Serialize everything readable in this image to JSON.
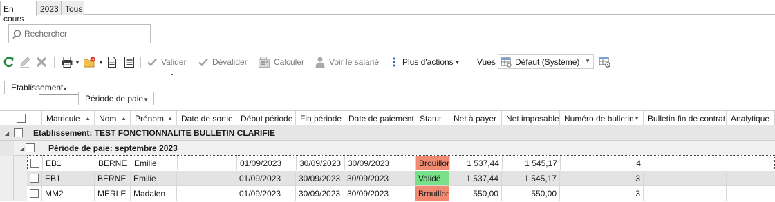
{
  "tabs": [
    {
      "label": "En cours",
      "active": true
    },
    {
      "label": "2023",
      "active": false
    },
    {
      "label": "Tous",
      "active": false
    }
  ],
  "search": {
    "placeholder": "Rechercher",
    "value": ""
  },
  "toolbar": {
    "validate_label": "Valider",
    "unvalidate_label": "Dévalider",
    "calculate_label": "Calculer",
    "view_employee_label": "Voir le salarié",
    "more_actions_label": "Plus d'actions",
    "views_label": "Vues",
    "views_selected": "Défaut (Système)"
  },
  "grouping": {
    "level1": "Etablissement",
    "level2": "Période de paie"
  },
  "columns": [
    "Matricule",
    "Nom",
    "Prénom",
    "Date de sortie",
    "Début période",
    "Fin période",
    "Date de paiement",
    "Statut",
    "Net à payer",
    "Net imposable",
    "Numéro de bulletin",
    "Bulletin fin de contrat",
    "Analytique"
  ],
  "groups": {
    "establishment": "Etablissement: TEST FONCTIONNALITE BULLETIN CLARIFIE",
    "period": "Période de paie: septembre 2023"
  },
  "rows": [
    {
      "matricule": "EB1",
      "nom": "BERNE",
      "prenom": "Emilie",
      "date_sortie": "",
      "debut": "01/09/2023",
      "fin": "30/09/2023",
      "paiement": "30/09/2023",
      "statut": "Brouillon",
      "net_payer": "1 537,44",
      "net_imposable": "1 545,17",
      "numero": "4",
      "fin_contrat": "",
      "analytique": ""
    },
    {
      "matricule": "EB1",
      "nom": "BERNE",
      "prenom": "Emilie",
      "date_sortie": "",
      "debut": "01/09/2023",
      "fin": "30/09/2023",
      "paiement": "30/09/2023",
      "statut": "Validé",
      "net_payer": "1 537,44",
      "net_imposable": "1 545,17",
      "numero": "3",
      "fin_contrat": "",
      "analytique": ""
    },
    {
      "matricule": "MM2",
      "nom": "MERLE",
      "prenom": "Madalen",
      "date_sortie": "",
      "debut": "01/09/2023",
      "fin": "30/09/2023",
      "paiement": "30/09/2023",
      "statut": "Brouillon",
      "net_payer": "550,00",
      "net_imposable": "550,00",
      "numero": "3",
      "fin_contrat": "",
      "analytique": ""
    }
  ],
  "colors": {
    "draft": "#f08a70",
    "validated": "#79e08a",
    "refresh": "#1e8a3c"
  },
  "icons": [
    "refresh-icon",
    "edit-icon",
    "delete-icon",
    "print-icon",
    "export-icon",
    "document-icon",
    "document-list-icon",
    "check-icon",
    "calculator-icon",
    "person-icon",
    "more-vertical-icon",
    "grid-view-icon",
    "grid-settings-icon",
    "search-icon"
  ]
}
